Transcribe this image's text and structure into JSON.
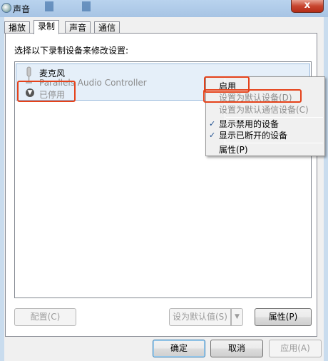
{
  "window": {
    "title": "声音",
    "close_label": "x"
  },
  "tabs": [
    {
      "label": "播放"
    },
    {
      "label": "录制"
    },
    {
      "label": "声音"
    },
    {
      "label": "通信"
    }
  ],
  "panel": {
    "instruction": "选择以下录制设备来修改设置:",
    "devices": [
      {
        "name": "麦克风",
        "description": "Parallels Audio Controller",
        "status": "已停用"
      }
    ]
  },
  "buttons": {
    "configure": "配置(C)",
    "set_default": "设为默认值(S)",
    "properties": "属性(P)",
    "ok": "确定",
    "cancel": "取消",
    "apply": "应用(A)"
  },
  "context_menu": {
    "items": [
      {
        "label": "启用",
        "enabled": true,
        "checked": false
      },
      {
        "label": "设置为默认设备(D)",
        "enabled": false,
        "checked": false
      },
      {
        "label": "设置为默认通信设备(C)",
        "enabled": false,
        "checked": false
      },
      {
        "label": "显示禁用的设备",
        "enabled": true,
        "checked": true
      },
      {
        "label": "显示已断开的设备",
        "enabled": true,
        "checked": true
      },
      {
        "label": "属性(P)",
        "enabled": true,
        "checked": false
      }
    ],
    "check_mark": "✓"
  },
  "colors": {
    "annotation": "#e5421a",
    "selection": "#e5eff9",
    "frame": "#c9dcee"
  }
}
